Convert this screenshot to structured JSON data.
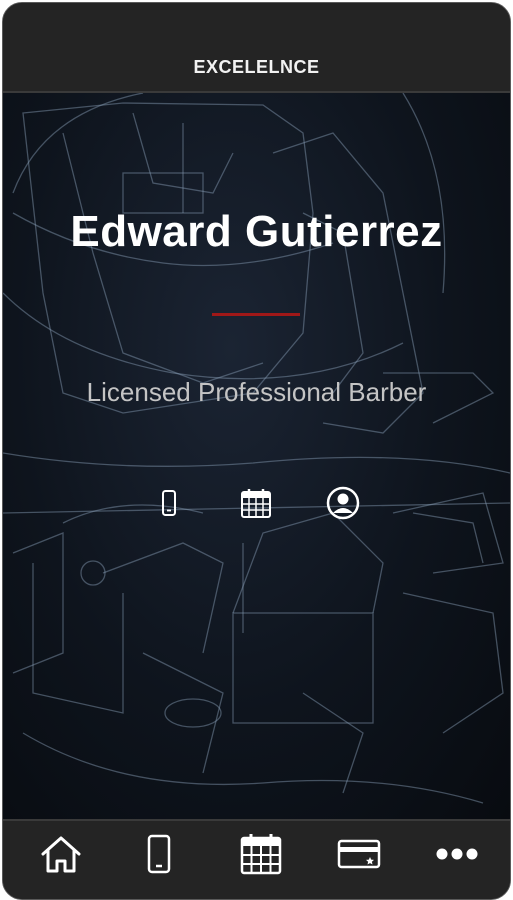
{
  "header": {
    "brand": "EXCELELNCE"
  },
  "profile": {
    "name": "Edward Gutierrez",
    "title": "Licensed Professional Barber"
  },
  "profile_actions": [
    {
      "icon": "mobile-phone-icon"
    },
    {
      "icon": "calendar-icon"
    },
    {
      "icon": "user-circle-icon"
    }
  ],
  "bottom_nav": [
    {
      "icon": "home-icon"
    },
    {
      "icon": "mobile-phone-icon"
    },
    {
      "icon": "calendar-icon"
    },
    {
      "icon": "credit-card-icon"
    },
    {
      "icon": "more-icon"
    }
  ],
  "colors": {
    "bar_background": "#242424",
    "hero_background": "#0e141d",
    "accent_divider": "#a01818",
    "name_text": "#ffffff",
    "subtitle_text": "#c4c4c4",
    "icon": "#ffffff"
  }
}
